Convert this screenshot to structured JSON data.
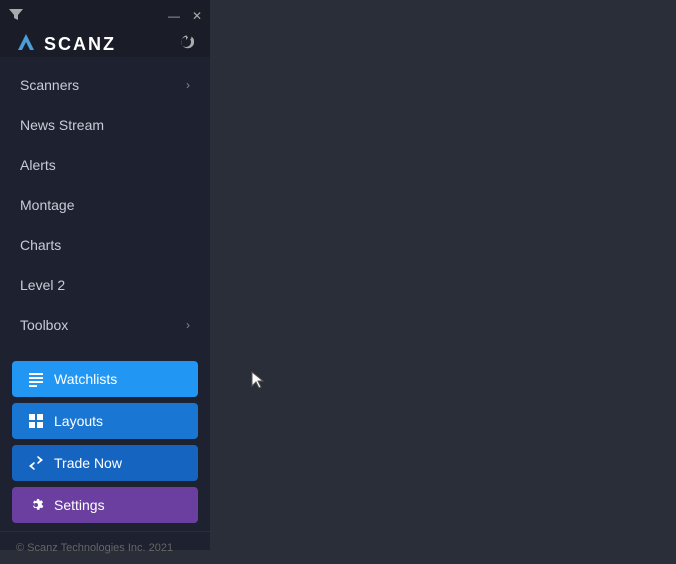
{
  "titlebar": {
    "minimize_label": "—",
    "close_label": "✕"
  },
  "logo": {
    "text": "SCANZ"
  },
  "nav": {
    "items": [
      {
        "label": "Scanners",
        "has_chevron": true
      },
      {
        "label": "News Stream",
        "has_chevron": false
      },
      {
        "label": "Alerts",
        "has_chevron": false
      },
      {
        "label": "Montage",
        "has_chevron": false
      },
      {
        "label": "Charts",
        "has_chevron": false
      },
      {
        "label": "Level 2",
        "has_chevron": false
      },
      {
        "label": "Toolbox",
        "has_chevron": true
      }
    ]
  },
  "buttons": {
    "watchlists": "Watchlists",
    "layouts": "Layouts",
    "trade_now": "Trade Now",
    "settings": "Settings"
  },
  "footer": {
    "text": "© Scanz Technologies Inc. 2021"
  }
}
